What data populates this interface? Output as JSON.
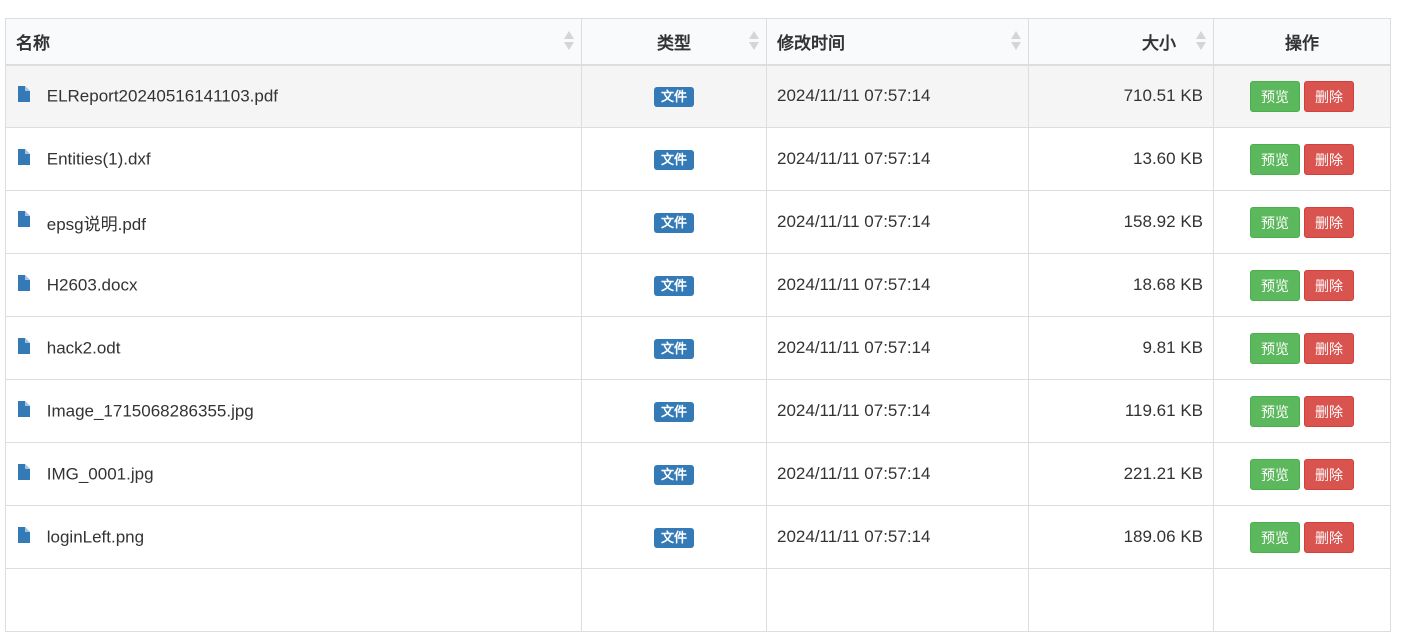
{
  "table": {
    "headers": {
      "name": "名称",
      "type": "类型",
      "modified": "修改时间",
      "size": "大小",
      "actions": "操作"
    },
    "rows": [
      {
        "name": "ELReport20240516141103.pdf",
        "type": "文件",
        "modified": "2024/11/11 07:57:14",
        "size": "710.51 KB",
        "preview": "预览",
        "delete": "删除"
      },
      {
        "name": "Entities(1).dxf",
        "type": "文件",
        "modified": "2024/11/11 07:57:14",
        "size": "13.60 KB",
        "preview": "预览",
        "delete": "删除"
      },
      {
        "name": "epsg说明.pdf",
        "type": "文件",
        "modified": "2024/11/11 07:57:14",
        "size": "158.92 KB",
        "preview": "预览",
        "delete": "删除"
      },
      {
        "name": "H2603.docx",
        "type": "文件",
        "modified": "2024/11/11 07:57:14",
        "size": "18.68 KB",
        "preview": "预览",
        "delete": "删除"
      },
      {
        "name": "hack2.odt",
        "type": "文件",
        "modified": "2024/11/11 07:57:14",
        "size": "9.81 KB",
        "preview": "预览",
        "delete": "删除"
      },
      {
        "name": "Image_1715068286355.jpg",
        "type": "文件",
        "modified": "2024/11/11 07:57:14",
        "size": "119.61 KB",
        "preview": "预览",
        "delete": "删除"
      },
      {
        "name": "IMG_0001.jpg",
        "type": "文件",
        "modified": "2024/11/11 07:57:14",
        "size": "221.21 KB",
        "preview": "预览",
        "delete": "删除"
      },
      {
        "name": "loginLeft.png",
        "type": "文件",
        "modified": "2024/11/11 07:57:14",
        "size": "189.06 KB",
        "preview": "预览",
        "delete": "删除"
      },
      {
        "name": "",
        "type": "",
        "modified": "",
        "size": "",
        "preview": "",
        "delete": ""
      }
    ]
  },
  "colors": {
    "badge": "#337ab7",
    "preview_button": "#5cb85c",
    "delete_button": "#d9534f",
    "file_icon": "#337ab7",
    "highlight_row": "#f5f5f5"
  },
  "icons": {
    "file": "file-icon",
    "sort": "sort-icon"
  }
}
